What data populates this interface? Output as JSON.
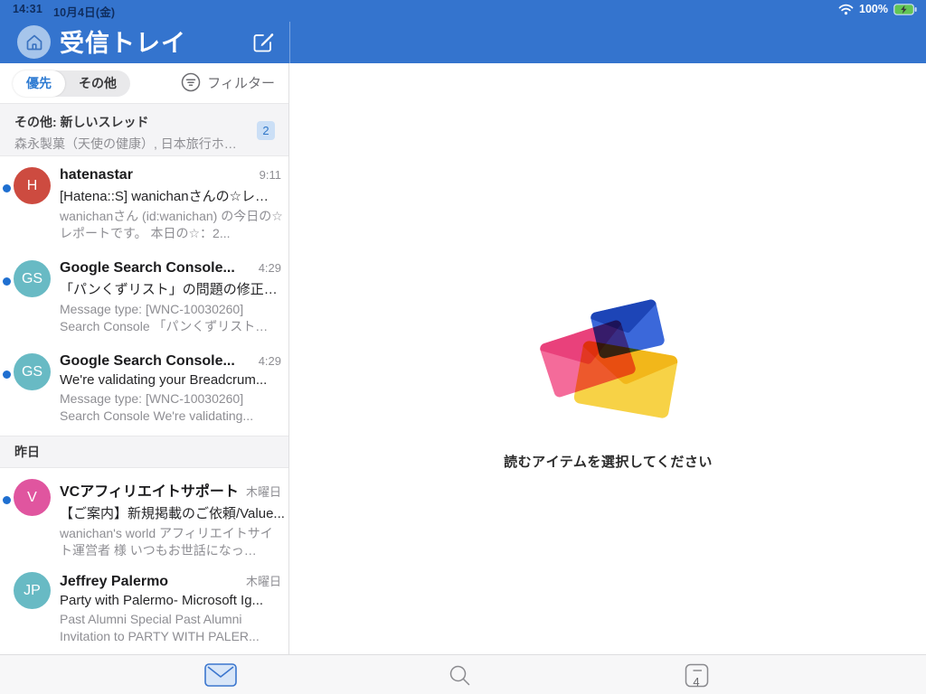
{
  "status_bar": {
    "time": "14:31",
    "date": "10月4日(金)",
    "battery": "100%"
  },
  "header": {
    "title": "受信トレイ"
  },
  "filter_bar": {
    "segments": [
      {
        "label": "優先",
        "selected": true
      },
      {
        "label": "その他",
        "selected": false
      }
    ],
    "filter_label": "フィルター"
  },
  "thread_banner": {
    "title": "その他: 新しいスレッド",
    "preview": "森永製菓（天使の健康）, 日本旅行ホ…",
    "badge": "2"
  },
  "message_list": {
    "items": [
      {
        "kind": "message",
        "initials": "H",
        "avatar_color": "#CD4B40",
        "unread": true,
        "sender": "hatenastar",
        "time": "9:11",
        "subject": "[Hatena::S] wanichanさんの☆レ…",
        "preview": "wanichanさん (id:wanichan) の今日の☆レポートです。 本日の☆：2..."
      },
      {
        "kind": "message",
        "initials": "GS",
        "avatar_color": "#68BAC4",
        "unread": true,
        "sender": "Google Search Console...",
        "time": "4:29",
        "subject": "「パンくずリスト」の問題の修正…",
        "preview": "Message type: [WNC-10030260] Search Console 「パンくずリスト…"
      },
      {
        "kind": "message",
        "initials": "GS",
        "avatar_color": "#68BAC4",
        "unread": true,
        "sender": "Google Search Console...",
        "time": "4:29",
        "subject": "We're validating your Breadcrum...",
        "preview": "Message type: [WNC-10030260] Search Console We're validating..."
      },
      {
        "kind": "section",
        "label": "昨日"
      },
      {
        "kind": "message",
        "initials": "V",
        "avatar_color": "#E0559F",
        "unread": true,
        "sender": "VCアフィリエイトサポート",
        "time": "木曜日",
        "subject": "【ご案内】新規掲載のご依頼/Value...",
        "preview": "wanichan's world アフィリエイトサイト運営者 様 いつもお世話になっ…"
      },
      {
        "kind": "message",
        "initials": "JP",
        "avatar_color": "#68BAC4",
        "unread": false,
        "sender": "Jeffrey Palermo",
        "time": "木曜日",
        "subject": "Party with Palermo- Microsoft Ig...",
        "preview": "Past Alumni Special Past Alumni Invitation to PARTY WITH PALER..."
      }
    ]
  },
  "reading_pane": {
    "empty_message": "読むアイテムを選択してください"
  },
  "tab_bar": {
    "calendar_day": "4"
  },
  "colors": {
    "chrome_blue": "#3474CE",
    "unread_dot": "#1F6FD0",
    "badge_bg": "#CBDFF6",
    "badge_text": "#3077C8",
    "battery_green": "#61C554"
  }
}
